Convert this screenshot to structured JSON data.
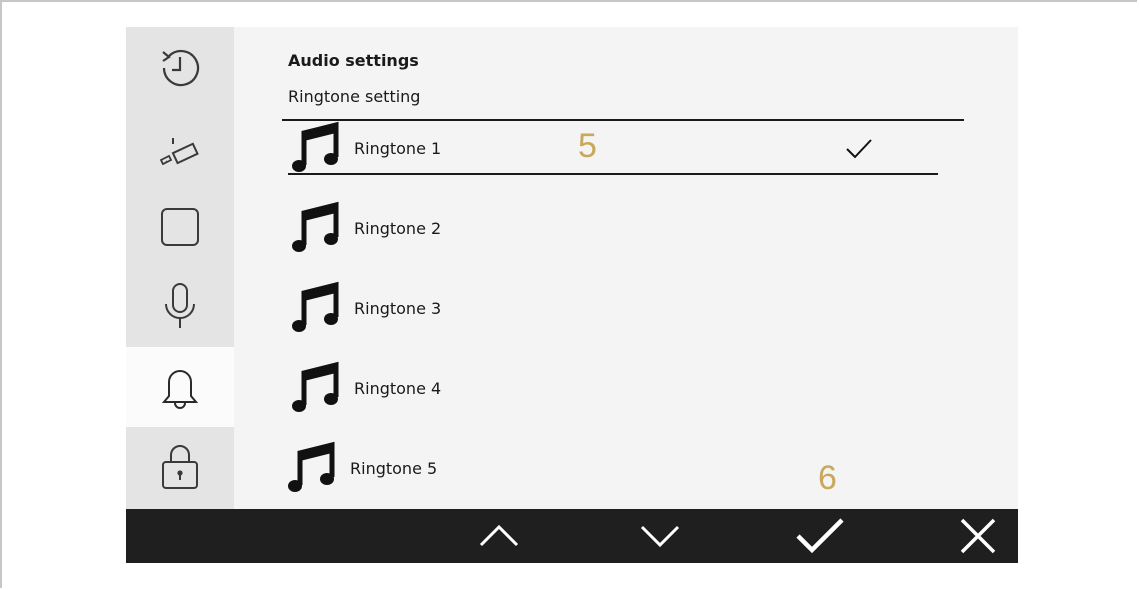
{
  "header": {
    "title": "Audio settings",
    "subtitle": "Ringtone setting"
  },
  "sidebar": {
    "items": [
      {
        "icon": "history-icon",
        "active": false
      },
      {
        "icon": "camera-icon",
        "active": false
      },
      {
        "icon": "square-icon",
        "active": false
      },
      {
        "icon": "microphone-icon",
        "active": false
      },
      {
        "icon": "bell-icon",
        "active": true
      },
      {
        "icon": "lock-icon",
        "active": false
      }
    ]
  },
  "ringtones": {
    "items": [
      {
        "label": "Ringtone 1",
        "selected": true
      },
      {
        "label": "Ringtone 2",
        "selected": false
      },
      {
        "label": "Ringtone 3",
        "selected": false
      },
      {
        "label": "Ringtone 4",
        "selected": false
      },
      {
        "label": "Ringtone 5",
        "selected": false
      }
    ]
  },
  "callouts": {
    "first": "5",
    "second": "6"
  },
  "toolbar": {
    "buttons": [
      "up-icon",
      "down-icon",
      "confirm-icon",
      "close-icon"
    ]
  },
  "colors": {
    "panel": "#f4f4f4",
    "sidebar": "#e4e4e4",
    "active_sidebar": "#fbfbfb",
    "bottom_bar": "#1f1f1f",
    "callout": "#c8a95a"
  }
}
